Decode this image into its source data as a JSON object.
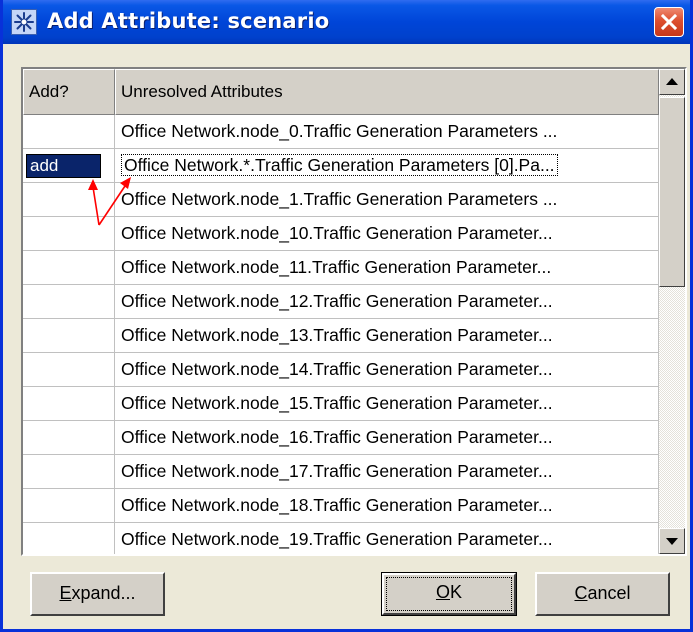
{
  "window": {
    "title": "Add Attribute: scenario",
    "icon": "star-app-icon",
    "close_icon": "close-x-icon",
    "title_bar_color": "#0054e3",
    "close_button_color": "#d9482b"
  },
  "table": {
    "columns": [
      "Add?",
      "Unresolved Attributes"
    ],
    "rows": [
      {
        "add": "",
        "attribute": "Office Network.node_0.Traffic Generation Parameters ..."
      },
      {
        "add": "add",
        "attribute": "Office Network.*.Traffic Generation Parameters [0].Pa..."
      },
      {
        "add": "",
        "attribute": "Office Network.node_1.Traffic Generation Parameters ..."
      },
      {
        "add": "",
        "attribute": "Office Network.node_10.Traffic Generation Parameter..."
      },
      {
        "add": "",
        "attribute": "Office Network.node_11.Traffic Generation Parameter..."
      },
      {
        "add": "",
        "attribute": "Office Network.node_12.Traffic Generation Parameter..."
      },
      {
        "add": "",
        "attribute": "Office Network.node_13.Traffic Generation Parameter..."
      },
      {
        "add": "",
        "attribute": "Office Network.node_14.Traffic Generation Parameter..."
      },
      {
        "add": "",
        "attribute": "Office Network.node_15.Traffic Generation Parameter..."
      },
      {
        "add": "",
        "attribute": "Office Network.node_16.Traffic Generation Parameter..."
      },
      {
        "add": "",
        "attribute": "Office Network.node_17.Traffic Generation Parameter..."
      },
      {
        "add": "",
        "attribute": "Office Network.node_18.Traffic Generation Parameter..."
      },
      {
        "add": "",
        "attribute": "Office Network.node_19.Traffic Generation Parameter..."
      }
    ],
    "selected_add_color": "#0a246a"
  },
  "scrollbar": {
    "up_icon": "scroll-up-arrow-icon",
    "down_icon": "scroll-down-arrow-icon"
  },
  "annotation": {
    "color": "#ff0000",
    "icon": "red-arrows-annotation"
  },
  "buttons": {
    "expand": {
      "pre": "",
      "u": "E",
      "post": "xpand..."
    },
    "ok": {
      "pre": "",
      "u": "O",
      "post": "K"
    },
    "cancel": {
      "pre": "",
      "u": "C",
      "post": "ancel"
    }
  }
}
